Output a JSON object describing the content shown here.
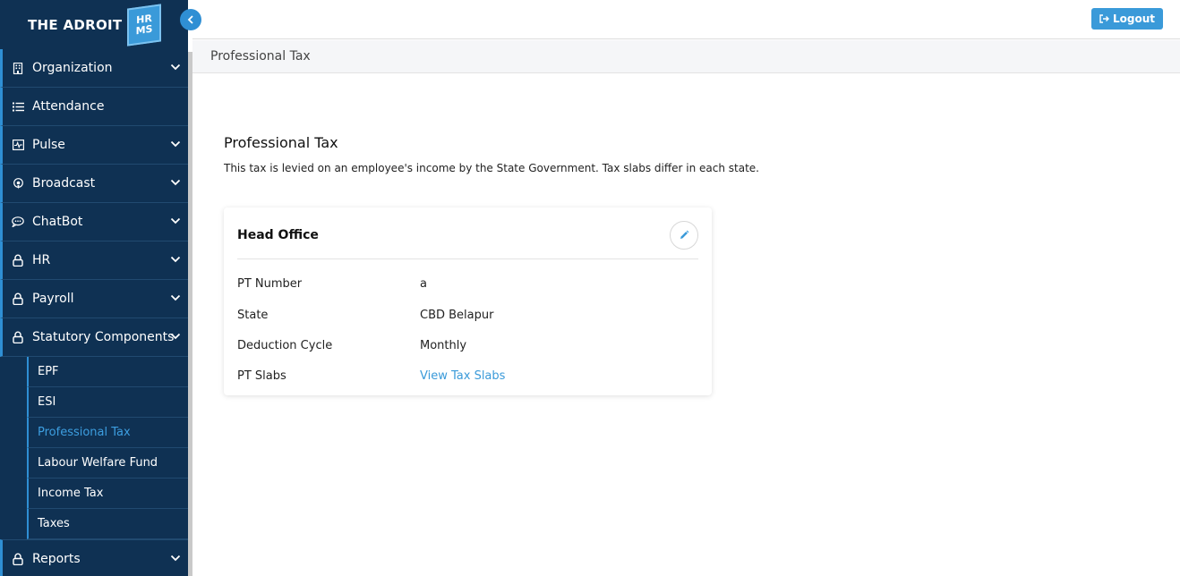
{
  "brand": {
    "name": "THE ADROIT",
    "badge_top": "HR",
    "badge_bottom": "MS"
  },
  "colors": {
    "sidebar_bg": "#0f3153",
    "accent": "#3a9ad9",
    "active_link": "#3d9ee0"
  },
  "sidebar": {
    "items": [
      {
        "label": "Organization",
        "icon": "building-icon",
        "has_chevron": true
      },
      {
        "label": "Attendance",
        "icon": "list-icon",
        "has_chevron": false
      },
      {
        "label": "Pulse",
        "icon": "pulse-icon",
        "has_chevron": true
      },
      {
        "label": "Broadcast",
        "icon": "broadcast-icon",
        "has_chevron": true
      },
      {
        "label": "ChatBot",
        "icon": "chat-icon",
        "has_chevron": true
      },
      {
        "label": "HR",
        "icon": "lock-icon",
        "has_chevron": true
      },
      {
        "label": "Payroll",
        "icon": "lock-icon",
        "has_chevron": true
      },
      {
        "label": "Statutory Components",
        "icon": "lock-icon",
        "has_chevron": true
      }
    ],
    "statutory_sub": [
      "EPF",
      "ESI",
      "Professional Tax",
      "Labour Welfare Fund",
      "Income Tax",
      "Taxes"
    ],
    "active_sub": "Professional Tax",
    "reports": {
      "label": "Reports",
      "icon": "lock-icon",
      "has_chevron": true
    }
  },
  "header": {
    "logout_label": "Logout",
    "breadcrumb": "Professional Tax"
  },
  "main": {
    "title": "Professional Tax",
    "description": "This tax is levied on an employee's income by the State Government. Tax slabs differ in each state.",
    "card": {
      "title": "Head Office",
      "rows": [
        {
          "label": "PT Number",
          "value": "a"
        },
        {
          "label": "State",
          "value": "CBD Belapur"
        },
        {
          "label": "Deduction Cycle",
          "value": "Monthly"
        },
        {
          "label": "PT Slabs",
          "value": "View Tax Slabs",
          "is_link": true
        }
      ]
    }
  }
}
